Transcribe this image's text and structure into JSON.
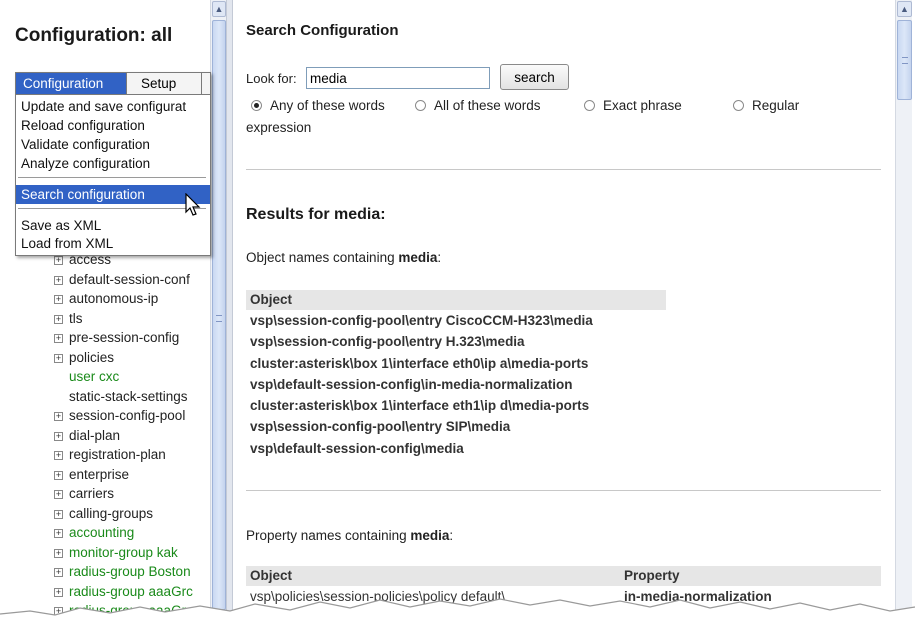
{
  "left": {
    "title": "Configuration: all",
    "menu": {
      "tabs": [
        "Configuration",
        "Setup"
      ],
      "items": [
        "Update and save configurat",
        "Reload configuration",
        "Validate configuration",
        "Analyze configuration",
        "Search configuration",
        "Save as XML",
        "Load from XML"
      ],
      "selected": "Search configuration"
    },
    "tree": [
      {
        "label": "access",
        "expand": "+"
      },
      {
        "label": "default-session-conf",
        "expand": "+"
      },
      {
        "label": "autonomous-ip",
        "expand": "+"
      },
      {
        "label": "tls",
        "expand": "+"
      },
      {
        "label": "pre-session-config",
        "expand": "+"
      },
      {
        "label": "policies",
        "expand": "+"
      },
      {
        "label": "user cxc",
        "expand": ""
      },
      {
        "label": "static-stack-settings",
        "expand": ""
      },
      {
        "label": "session-config-pool",
        "expand": "+"
      },
      {
        "label": "dial-plan",
        "expand": "+"
      },
      {
        "label": "registration-plan",
        "expand": "+"
      },
      {
        "label": "enterprise",
        "expand": "+"
      },
      {
        "label": "carriers",
        "expand": "+"
      },
      {
        "label": "calling-groups",
        "expand": "+"
      },
      {
        "label": "accounting",
        "expand": "+"
      },
      {
        "label": "monitor-group kak",
        "expand": "+"
      },
      {
        "label": "radius-group Boston",
        "expand": "+"
      },
      {
        "label": "radius-group aaaGrc",
        "expand": "+"
      },
      {
        "label": "radius-group aaaGrc",
        "expand": "+"
      }
    ]
  },
  "right": {
    "title": "Search Configuration",
    "lookfor_label": "Look for:",
    "search_value": "media",
    "search_button": "search",
    "radios": [
      "Any of these words",
      "All of these words",
      "Exact phrase",
      "Regular"
    ],
    "radio_cont": "expression",
    "selected_radio": "Any of these words",
    "results_heading": "Results for media:",
    "obj_label_prefix": "Object names containing ",
    "obj_label_term": "media",
    "obj_label_suffix": ":",
    "obj_header": "Object",
    "objects": [
      "vsp\\session-config-pool\\entry CiscoCCM-H323\\media",
      "vsp\\session-config-pool\\entry H.323\\media",
      "cluster:asterisk\\box 1\\interface eth0\\ip a\\media-ports",
      "vsp\\default-session-config\\in-media-normalization",
      "cluster:asterisk\\box 1\\interface eth1\\ip d\\media-ports",
      "vsp\\session-config-pool\\entry SIP\\media",
      "vsp\\default-session-config\\media"
    ],
    "prop_label_prefix": "Property names containing ",
    "prop_label_term": "media",
    "prop_label_suffix": ":",
    "prop_headers": [
      "Object",
      "Property"
    ],
    "properties": [
      {
        "object": "vsp\\policies\\session-policies\\policy default\\",
        "property": "in-media-normalization"
      }
    ]
  }
}
